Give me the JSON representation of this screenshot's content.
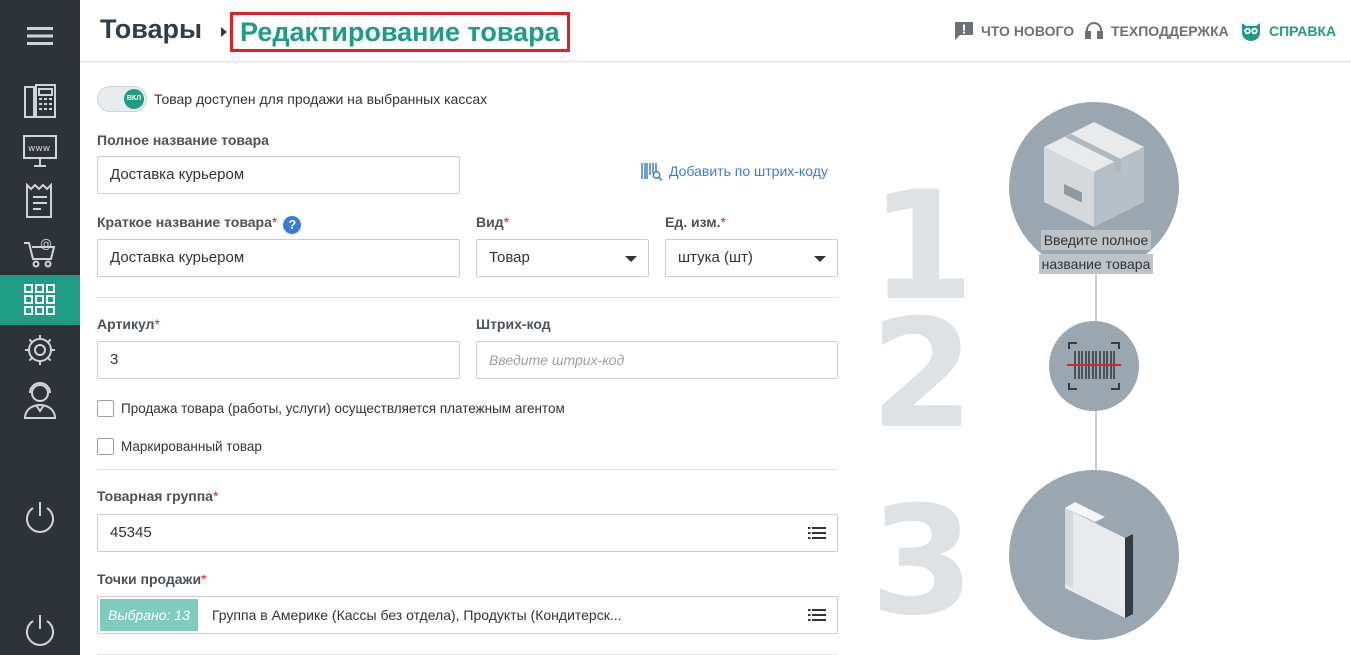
{
  "sidebar": {
    "items": [
      {
        "icon": "menu-icon"
      },
      {
        "icon": "cash-register-icon"
      },
      {
        "icon": "www-icon"
      },
      {
        "icon": "receipt-icon"
      },
      {
        "icon": "shop-cart-icon"
      },
      {
        "icon": "grid-icon",
        "active": true
      },
      {
        "icon": "gear-icon"
      },
      {
        "icon": "support-agent-icon"
      },
      {
        "icon": "power-icon"
      },
      {
        "icon": "power-icon"
      }
    ]
  },
  "header": {
    "breadcrumb_root": "Товары",
    "breadcrumb_current": "Редактирование товара",
    "whats_new": "ЧТО НОВОГО",
    "support": "ТЕХПОДДЕРЖКА",
    "help": "СПРАВКА"
  },
  "form": {
    "toggle_state": "ВКЛ",
    "toggle_label": "Товар доступен для продажи на выбранных кассах",
    "full_name_label": "Полное название товара",
    "full_name_value": "Доставка курьером",
    "barcode_link": "Добавить по штрих-коду",
    "short_name_label": "Краткое название товара",
    "short_name_value": "Доставка курьером",
    "help_mark": "?",
    "type_label": "Вид",
    "type_value": "Товар",
    "unit_label": "Ед. изм.",
    "unit_value": "штука (шт)",
    "article_label": "Артикул",
    "article_value": "3",
    "barcode_label": "Штрих-код",
    "barcode_placeholder": "Введите штрих-код",
    "agent_checkbox_label": "Продажа товара (работы, услуги) осуществляется платежным агентом",
    "marked_checkbox_label": "Маркированный товар",
    "group_label": "Товарная группа",
    "group_value": "45345",
    "points_label": "Точки продажи",
    "points_chip": "Выбрано: 13",
    "points_value": "Группа в Америке (Кассы без отдела), Продукты (Кондитерск..."
  },
  "steps": {
    "n1": "1",
    "n2": "2",
    "n3": "3",
    "caption_line1": "Введите полное",
    "caption_line2": "название товара"
  },
  "colors": {
    "accent": "#1e9c85",
    "sidebar": "#2e3338",
    "highlight_border": "#e21e26",
    "link": "#3d7bd9"
  }
}
